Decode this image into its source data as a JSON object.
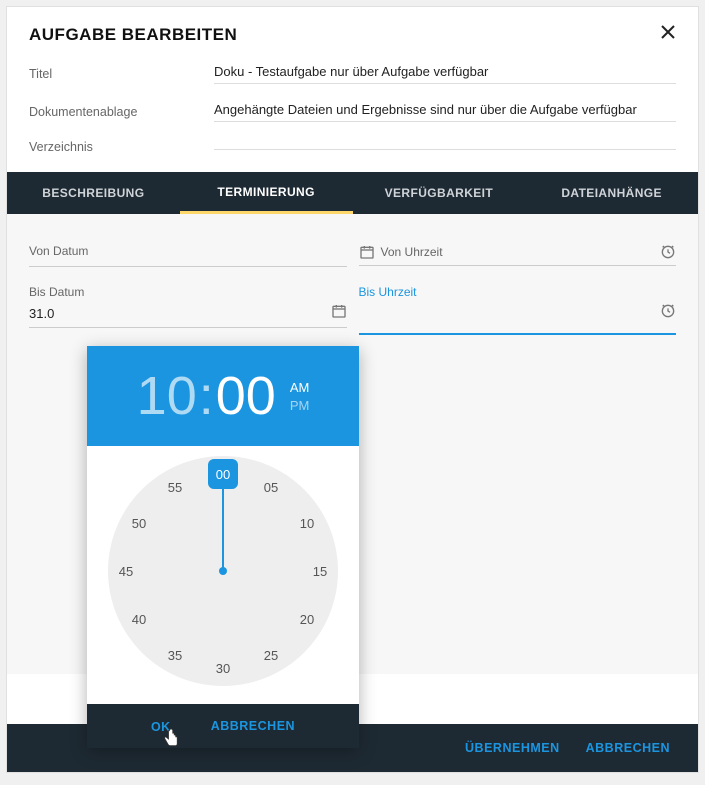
{
  "dialog": {
    "title": "AUFGABE BEARBEITEN"
  },
  "form": {
    "title_label": "Titel",
    "title_value": "Doku - Testaufgabe nur über Aufgabe verfügbar",
    "docstore_label": "Dokumentenablage",
    "docstore_value": "Angehängte Dateien und Ergebnisse sind nur über die Aufgabe verfügbar",
    "directory_label": "Verzeichnis",
    "directory_value": ""
  },
  "tabs": [
    {
      "label": "BESCHREIBUNG",
      "active": false
    },
    {
      "label": "TERMINIERUNG",
      "active": true
    },
    {
      "label": "VERFÜGBARKEIT",
      "active": false
    },
    {
      "label": "DATEIANHÄNGE",
      "active": false
    }
  ],
  "scheduling": {
    "from_date_label": "Von Datum",
    "from_date_value": "",
    "from_time_label": "Von Uhrzeit",
    "to_date_label": "Bis Datum",
    "to_date_value": "31.0",
    "to_time_label": "Bis Uhrzeit"
  },
  "timepicker": {
    "hours": "10",
    "minutes": "00",
    "am_label": "AM",
    "pm_label": "PM",
    "selected_period": "AM",
    "ticks": [
      "00",
      "05",
      "10",
      "15",
      "20",
      "25",
      "30",
      "35",
      "40",
      "45",
      "50",
      "55"
    ],
    "selected_tick": "00",
    "ok_label": "OK",
    "cancel_label": "ABBRECHEN"
  },
  "footer": {
    "apply_label": "ÜBERNEHMEN",
    "cancel_label": "ABBRECHEN"
  }
}
